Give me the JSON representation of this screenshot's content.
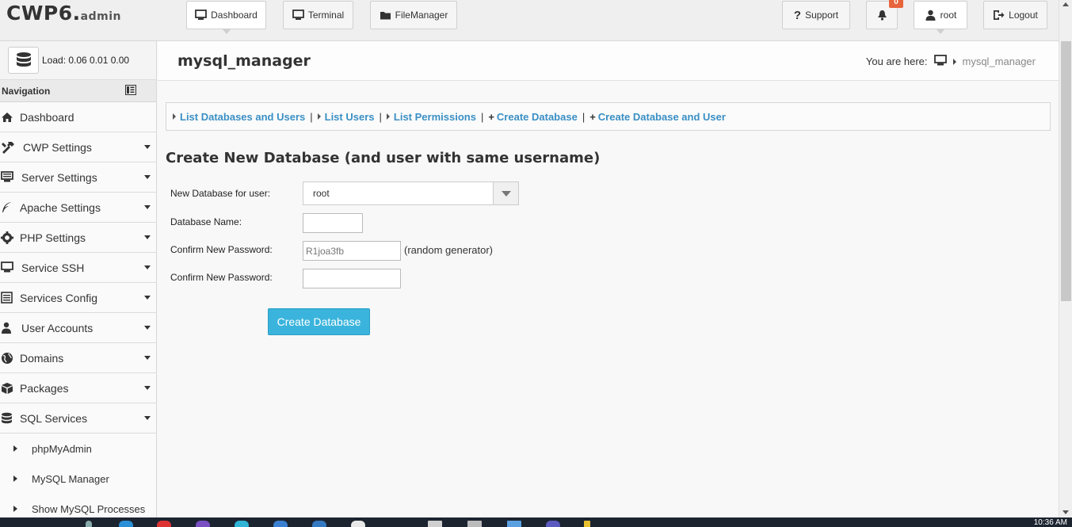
{
  "brand": {
    "main": "CWP6.",
    "sub": "admin"
  },
  "topnav": {
    "dashboard": "Dashboard",
    "terminal": "Terminal",
    "filemanager": "FileManager",
    "support": "Support",
    "notifications_count": "0",
    "user": "root",
    "logout": "Logout"
  },
  "sidebar": {
    "load_label": "Load: 0.06  0.01  0.00",
    "nav_title": "Navigation",
    "items": [
      {
        "label": "Dashboard",
        "icon": "home-icon"
      },
      {
        "label": "CWP Settings",
        "icon": "tools-icon"
      },
      {
        "label": "Server Settings",
        "icon": "server-icon"
      },
      {
        "label": "Apache Settings",
        "icon": "feather-icon"
      },
      {
        "label": "PHP Settings",
        "icon": "gear-icon"
      },
      {
        "label": "Service SSH",
        "icon": "monitor-icon"
      },
      {
        "label": "Services Config",
        "icon": "list-icon"
      },
      {
        "label": "User Accounts",
        "icon": "user-icon"
      },
      {
        "label": "Domains",
        "icon": "globe-icon"
      },
      {
        "label": "Packages",
        "icon": "box-icon"
      },
      {
        "label": "SQL Services",
        "icon": "database-icon"
      }
    ],
    "sql_sub": [
      "phpMyAdmin",
      "MySQL Manager",
      "Show MySQL Processes"
    ]
  },
  "header": {
    "title": "mysql_manager",
    "you_are_here": "You are here:",
    "current": "mysql_manager"
  },
  "tabs": {
    "list_db_users": "List Databases and Users",
    "list_users": "List Users",
    "list_permissions": "List Permissions",
    "create_db": "Create Database",
    "create_db_user": "Create Database and User"
  },
  "form": {
    "title": "Create New Database (and user with same username)",
    "user_label": "New Database for user:",
    "user_value": "root",
    "db_name_label": "Database Name:",
    "db_name_value": "",
    "password_label": "Confirm New Password:",
    "password_value": "R1joa3fb",
    "random_hint": "(random generator)",
    "confirm_label": "Confirm New Password:",
    "confirm_value": "",
    "submit": "Create Database"
  },
  "taskbar": {
    "time": "10:36 AM"
  },
  "colors": {
    "link": "#3a8fc4",
    "button": "#3ab4dc",
    "badge": "#e8643b"
  }
}
